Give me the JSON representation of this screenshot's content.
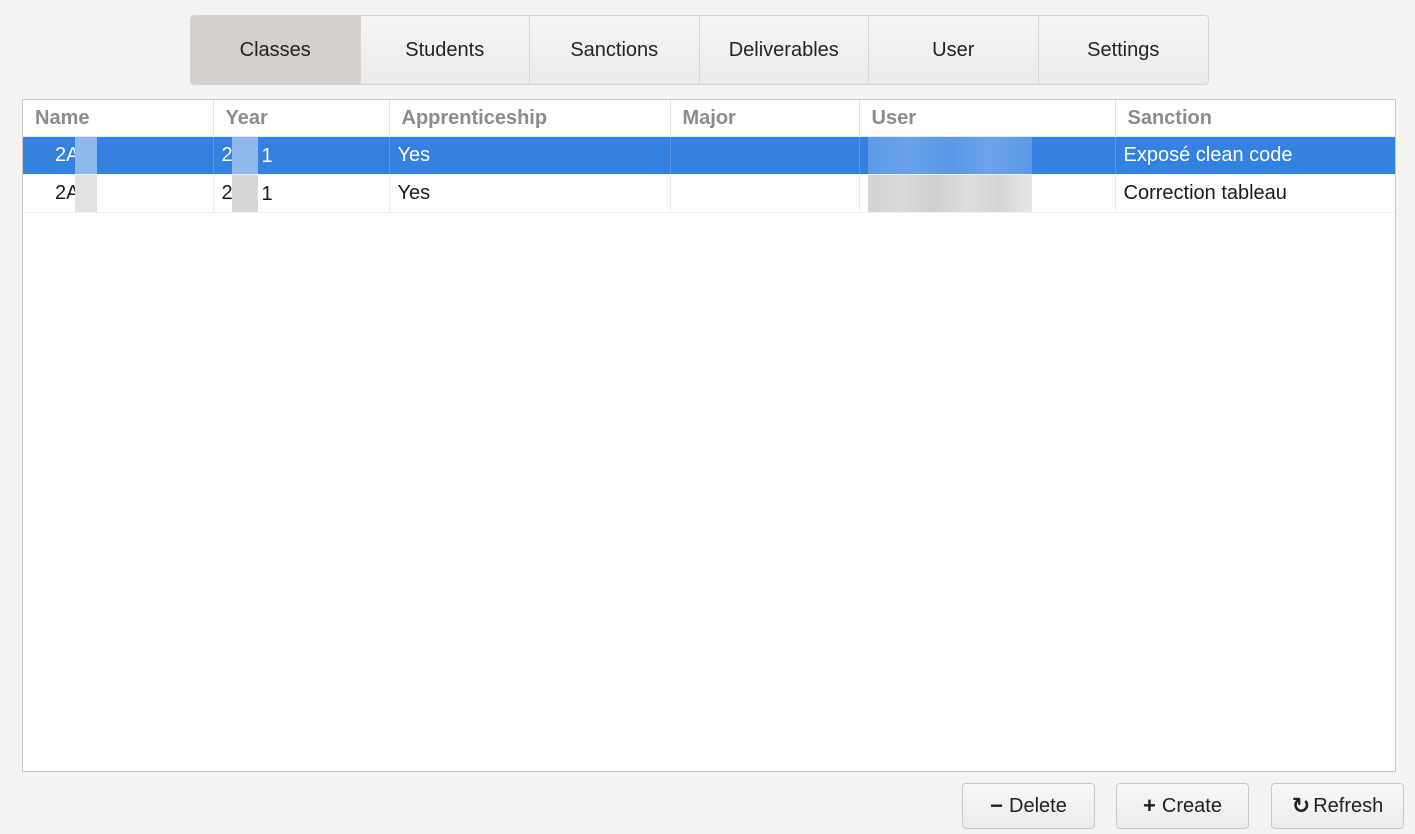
{
  "tabs": [
    {
      "label": "Classes",
      "active": true
    },
    {
      "label": "Students",
      "active": false
    },
    {
      "label": "Sanctions",
      "active": false
    },
    {
      "label": "Deliverables",
      "active": false
    },
    {
      "label": "User",
      "active": false
    },
    {
      "label": "Settings",
      "active": false
    }
  ],
  "table": {
    "columns": [
      "Name",
      "Year",
      "Apprenticeship",
      "Major",
      "User",
      "Sanction"
    ],
    "rows": [
      {
        "name": "2A",
        "year": "2",
        "year_tail": "1",
        "apprenticeship": "Yes",
        "major": "",
        "user": "",
        "sanction": "Exposé clean code",
        "selected": true
      },
      {
        "name": "2A",
        "year": "2",
        "year_tail": "1",
        "apprenticeship": "Yes",
        "major": "",
        "user": "",
        "sanction": "Correction tableau",
        "selected": false
      }
    ]
  },
  "buttons": {
    "delete_icon": "−",
    "delete_label": "Delete",
    "create_icon": "+",
    "create_label": "Create",
    "refresh_icon": "↻",
    "refresh_label": "Refresh"
  },
  "colors": {
    "selection": "#3581e0",
    "tab_active": "#d3cfcb",
    "background": "#f4f3f2"
  }
}
